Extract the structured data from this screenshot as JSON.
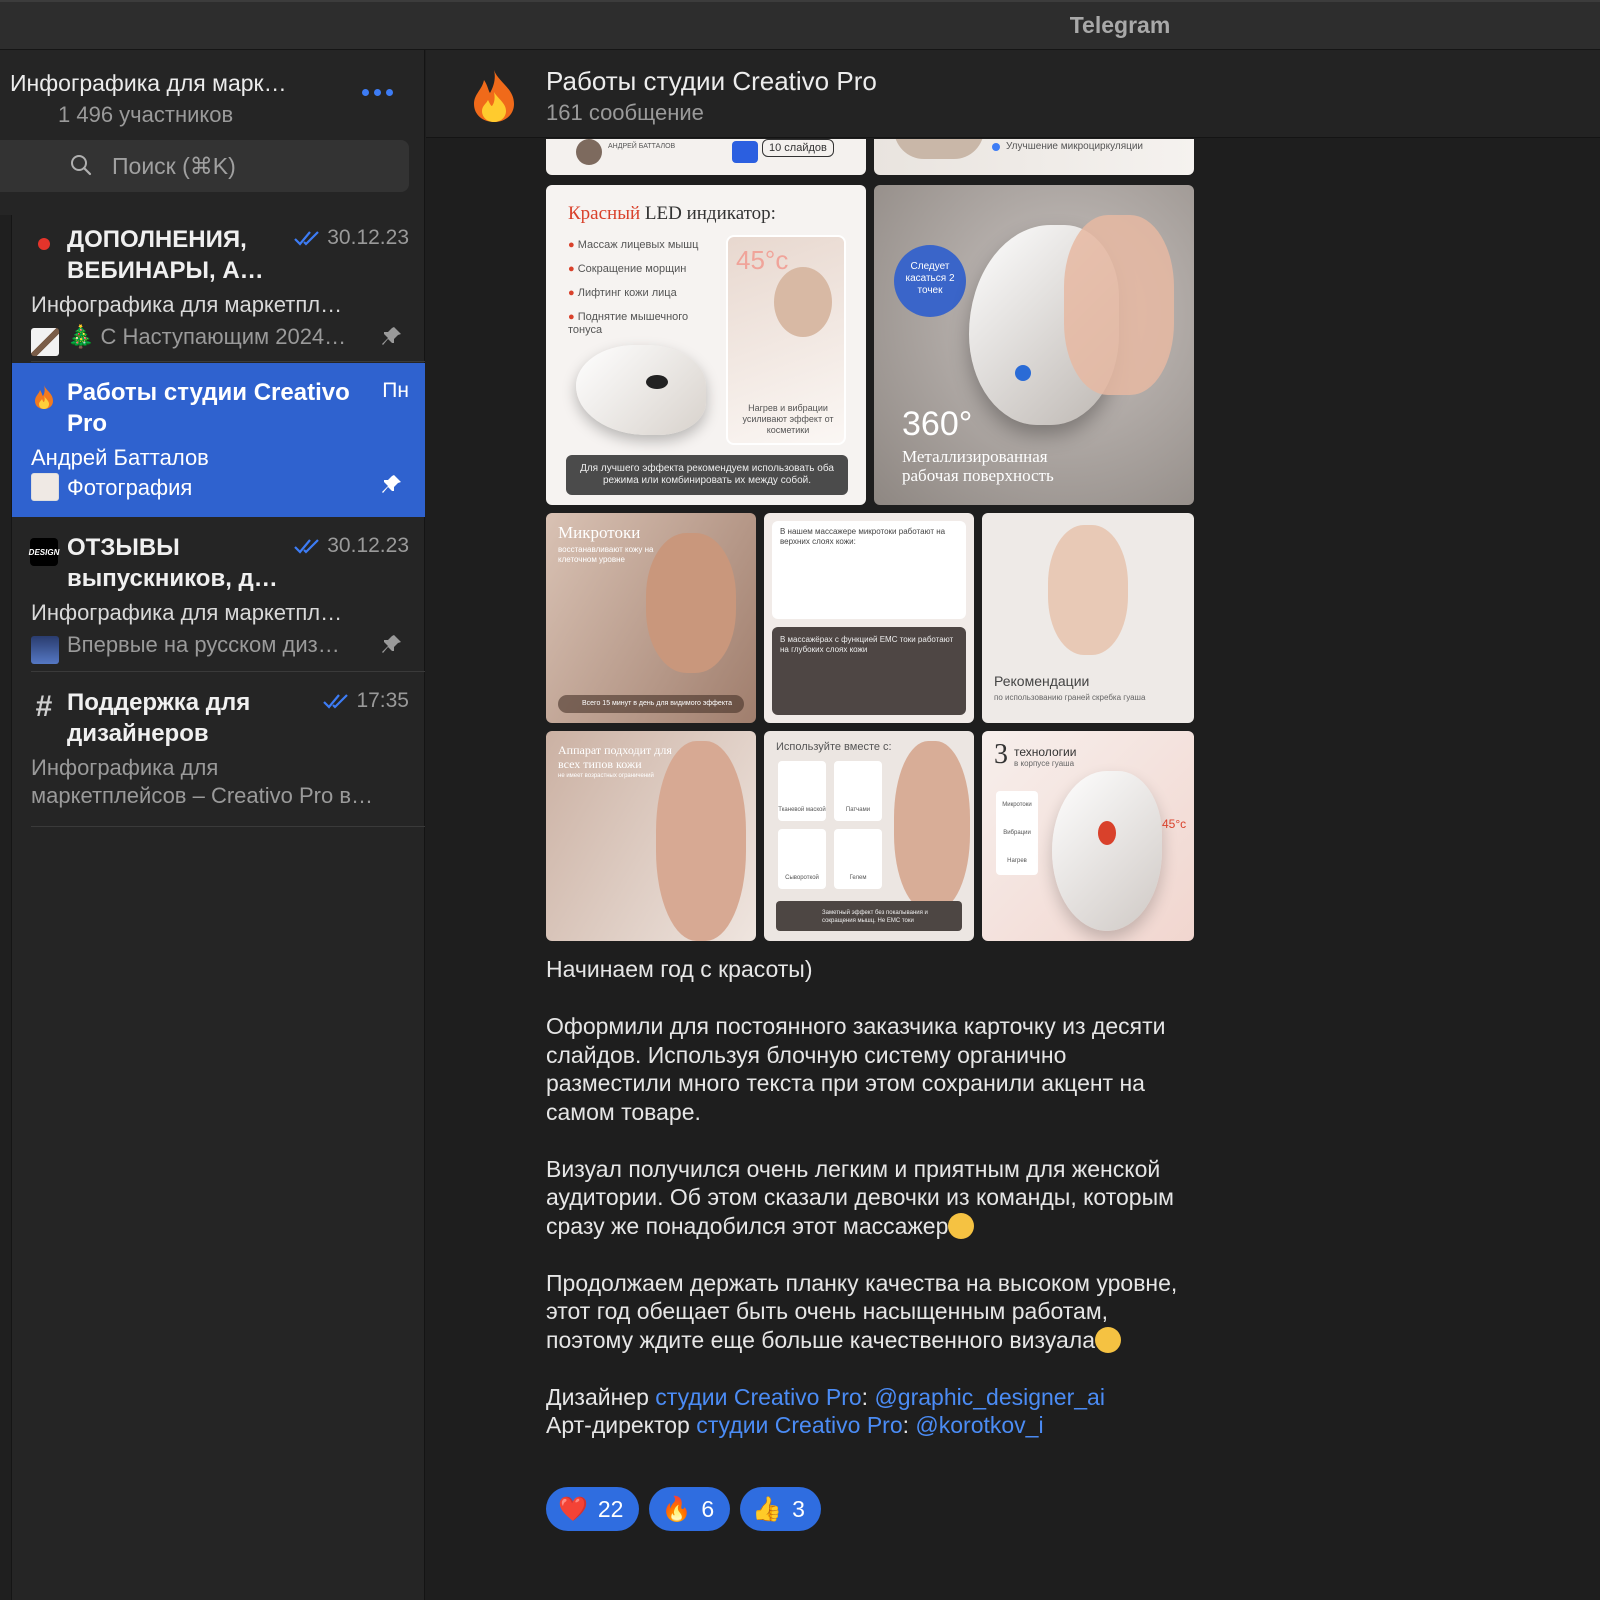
{
  "window": {
    "title": "Telegram"
  },
  "group": {
    "title": "Инфографика для марк…",
    "subtitle": "1 496 участников"
  },
  "search": {
    "placeholder": "Поиск (⌘K)"
  },
  "chats": [
    {
      "name": "ДОПОЛНЕНИЯ, ВЕБИНАРЫ, А…",
      "date": "30.12.23",
      "line1": "Инфографика для маркетпл…",
      "line2": "🎄 С Наступающим 2024…"
    },
    {
      "name": "Работы студии Creativo Pro",
      "date": "Пн",
      "line1": "Андрей Батталов",
      "line2": "Фотография"
    },
    {
      "name": "ОТЗЫВЫ выпускников, д…",
      "date": "30.12.23",
      "line1": "Инфографика для маркетпл…",
      "line2": "Впервые на русском диз…"
    },
    {
      "name": "Поддержка для дизайнеров",
      "date": "17:35",
      "line1": "Инфографика для",
      "line2": "маркетплейсов – Creativo Pro в…"
    }
  ],
  "header": {
    "title": "Работы студии Creativo Pro",
    "subtitle": "161 сообщение"
  },
  "slides": {
    "top_left_author": "АНДРЕЙ БАТТАЛОВ",
    "top_left_badge": "10 слайдов",
    "top_right_text": "Улучшение микроциркуляции",
    "led_title_red": "Красный",
    "led_title_rest": "LED индикатор:",
    "led_items": [
      "Массаж лицевых мышц",
      "Сокращение морщин",
      "Лифтинг кожи лица",
      "Поднятие мышечного тонуса"
    ],
    "led_temp": "45°c",
    "led_note": "Нагрев и вибрации усиливают эффект от косметики",
    "led_footer": "Для лучшего эффекта рекомендуем использовать оба режима или комбинировать их между собой.",
    "points_badge": "Следует касаться 2 точек",
    "surface_deg": "360°",
    "surface_text": "Металлизированная рабочая поверхность",
    "micro_title": "Микротоки",
    "micro_sub": "восстанавливают кожу на клеточном уровне",
    "micro_footer": "Всего 15 минут в день для видимого эффекта",
    "compare_top": "В нашем массажере микротоки работают на верхних слоях кожи:",
    "compare_bottom": "В массажёрах с функцией ЕМС токи работают на глубоких слоях кожи",
    "rec_title": "Рекомендации",
    "rec_sub": "по использованию граней скребка гуаша",
    "skin_title": "Аппарат подходит для всех типов кожи",
    "skin_sub": "не имеет возрастных ограничений",
    "combo_title": "Используйте вместе с:",
    "combo_items": [
      "Тканевой маской",
      "Патчами",
      "Сывороткой",
      "Гелем"
    ],
    "combo_footer": "Заметный эффект без покалывания и сокращения мышц. Не EMC токи",
    "tech_num": "3",
    "tech_title": "технологии",
    "tech_sub": "в корпусе гуаша",
    "tech_items": [
      "Микротоки",
      "Вибрации",
      "Нагрев"
    ],
    "tech_temp": "45°c"
  },
  "message": {
    "p1": "Начинаем год с красоты)",
    "p2": "Оформили для постоянного заказчика карточку из десяти слайдов. Используя блочную систему органично разместили много текста при этом сохранили акцент на самом товаре.",
    "p3": "Визуал получился очень легким и приятным для женской аудитории. Об этом сказали девочки из команды, которым сразу же понадобился этот массажер",
    "p4": "Продолжаем держать планку качества на высоком уровне, этот год обещает быть очень насыщенным работам, поэтому ждите еще больше качественного визуала",
    "designer_label": "Дизайнер",
    "art_label": "Арт-директор",
    "studio_link": "студии Creativo Pro",
    "colon": ":",
    "designer_handle": "@graphic_designer_ai",
    "art_handle": "@korotkov_i"
  },
  "reactions": [
    {
      "icon": "heart-icon",
      "emoji": "❤️",
      "count": "22"
    },
    {
      "icon": "fire-icon",
      "emoji": "🔥",
      "count": "6"
    },
    {
      "icon": "thumbs-up-icon",
      "emoji": "👍",
      "count": "3"
    }
  ],
  "colors": {
    "accent": "#2f62cf",
    "link": "#4b8cf5",
    "reaction": "#2f6de0",
    "unread_dot": "#e5342b"
  }
}
